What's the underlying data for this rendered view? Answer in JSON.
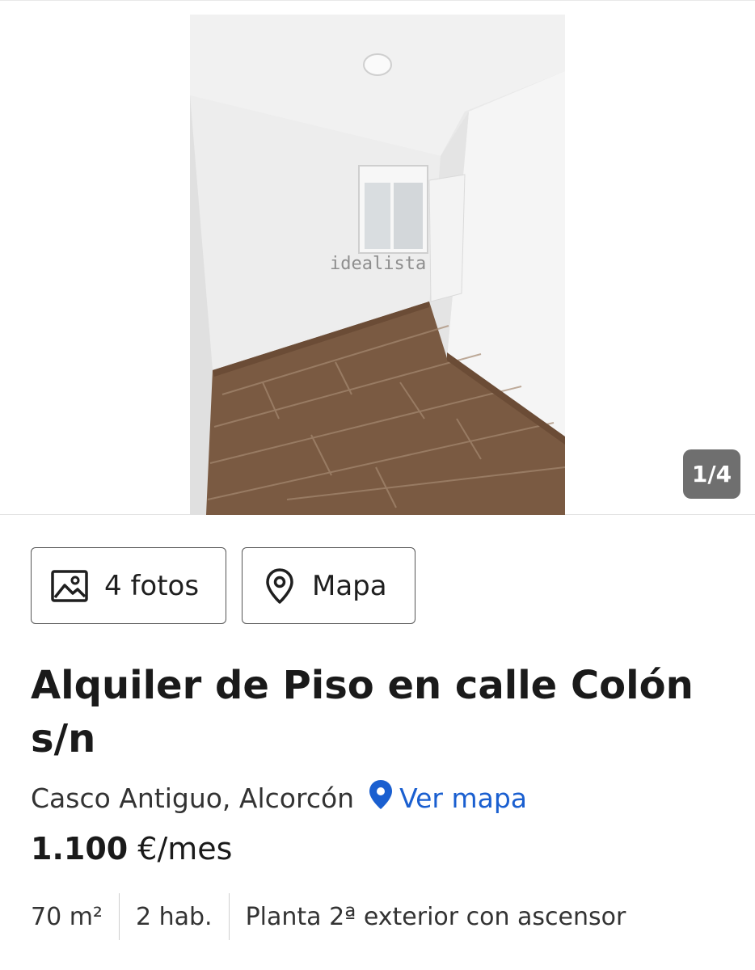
{
  "gallery": {
    "watermark": "idealista",
    "counter": "1/4"
  },
  "actions": {
    "photos_label": "4 fotos",
    "map_label": "Mapa"
  },
  "listing": {
    "title": "Alquiler de Piso en calle Colón s/n",
    "location": "Casco Antiguo, Alcorcón",
    "view_map_label": "Ver mapa",
    "price_amount": "1.100",
    "price_unit": "€/mes",
    "features": [
      "70 m²",
      "2 hab.",
      "Planta 2ª exterior con ascensor"
    ]
  },
  "colors": {
    "link": "#1a5fd0",
    "text": "#1f1f1f"
  },
  "icons": {
    "photos": "image-icon",
    "map": "map-pin-outline-icon",
    "view_map": "map-pin-filled-icon"
  }
}
